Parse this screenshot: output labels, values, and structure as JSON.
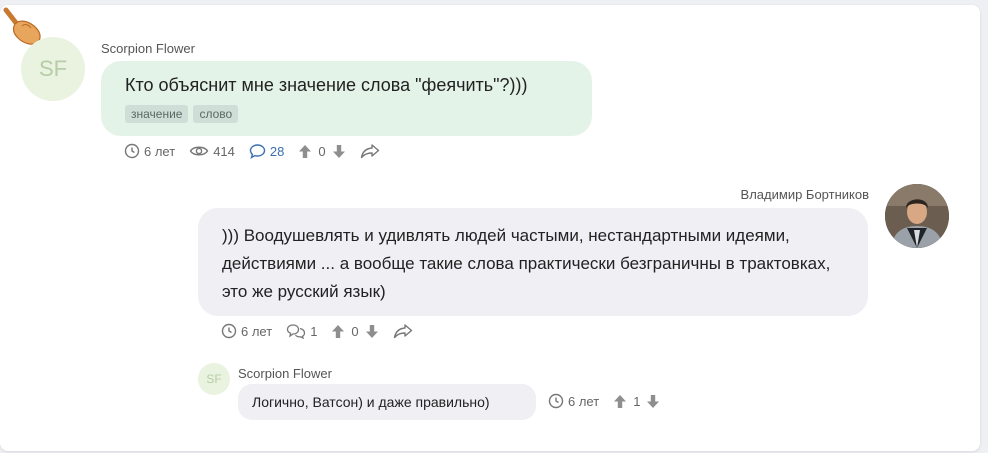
{
  "question": {
    "author": "Scorpion Flower",
    "avatar_initials": "SF",
    "text": "Кто объяснит мне значение слова \"феячить\"?)))",
    "tags": [
      "значение",
      "слово"
    ],
    "meta": {
      "age": "6 лет",
      "views": "414",
      "answers": "28",
      "votes": "0"
    }
  },
  "answer": {
    "author": "Владимир Бортников",
    "text": "))) Воодушевлять и удивлять людей частыми, нестандартными идеями, действиями ... а вообще такие слова практически безграничны в трактовках, это же русский язык)",
    "meta": {
      "age": "6 лет",
      "comments": "1",
      "votes": "0"
    }
  },
  "comment": {
    "author": "Scorpion Flower",
    "avatar_initials": "SF",
    "text": "Логично, Ватсон) и даже правильно)",
    "meta": {
      "age": "6 лет",
      "votes": "1"
    }
  },
  "colors": {
    "question_bubble": "#e4f3e8",
    "answer_bubble": "#efeff4",
    "link_blue": "#3b6fb0",
    "tag_bg": "#cfded6"
  }
}
